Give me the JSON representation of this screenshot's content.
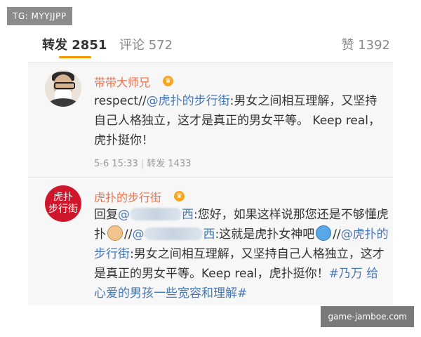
{
  "watermark_top": "TG: MYYJJPP",
  "watermark_bottom": "game-jamboe.com",
  "tabs": {
    "repost_label": "转发",
    "repost_count": "2851",
    "comment_label": "评论",
    "comment_count": "572",
    "like_label": "赞",
    "like_count": "1392"
  },
  "posts": [
    {
      "author": "带带大师兄",
      "verified_icon": "crown-badge-icon",
      "text_prefix": "respect//",
      "mention": "@虎扑的步行街",
      "text_rest": ":男女之间相互理解，又坚持自己人格独立，这才是真正的男女平等。 Keep real，虎扑挺你！",
      "time": "5-6 15:33",
      "repost_label": "转发",
      "repost_count": "1433"
    },
    {
      "author": "虎扑的步行街",
      "avatar_text_line1": "虎扑",
      "avatar_text_line2": "步行街",
      "verified_icon": "crown-badge-icon",
      "reply_prefix": "回复",
      "mention1_tail": "西",
      "text1": ":您好，如果这样说那您还是不够懂虎扑",
      "cat_emoji": "cat-emoji-icon",
      "slash1": "//",
      "mention2_tail": "西",
      "text2": ":这就是虎扑女神吧",
      "blue_emoji": "face-emoji-icon",
      "slash2": "//",
      "mention3": "@虎扑的步行街",
      "text3": ":男女之间相互理解，又坚持自己人格独立，这才是真正的男女平等。Keep real，虎扑挺你！",
      "hashtag": "#乃万 给心爱的男孩一些宽容和理解#"
    }
  ],
  "colors": {
    "accent": "#f39800",
    "name": "#eb7350",
    "link": "#4878b6",
    "panel": "#f7f7f7"
  }
}
